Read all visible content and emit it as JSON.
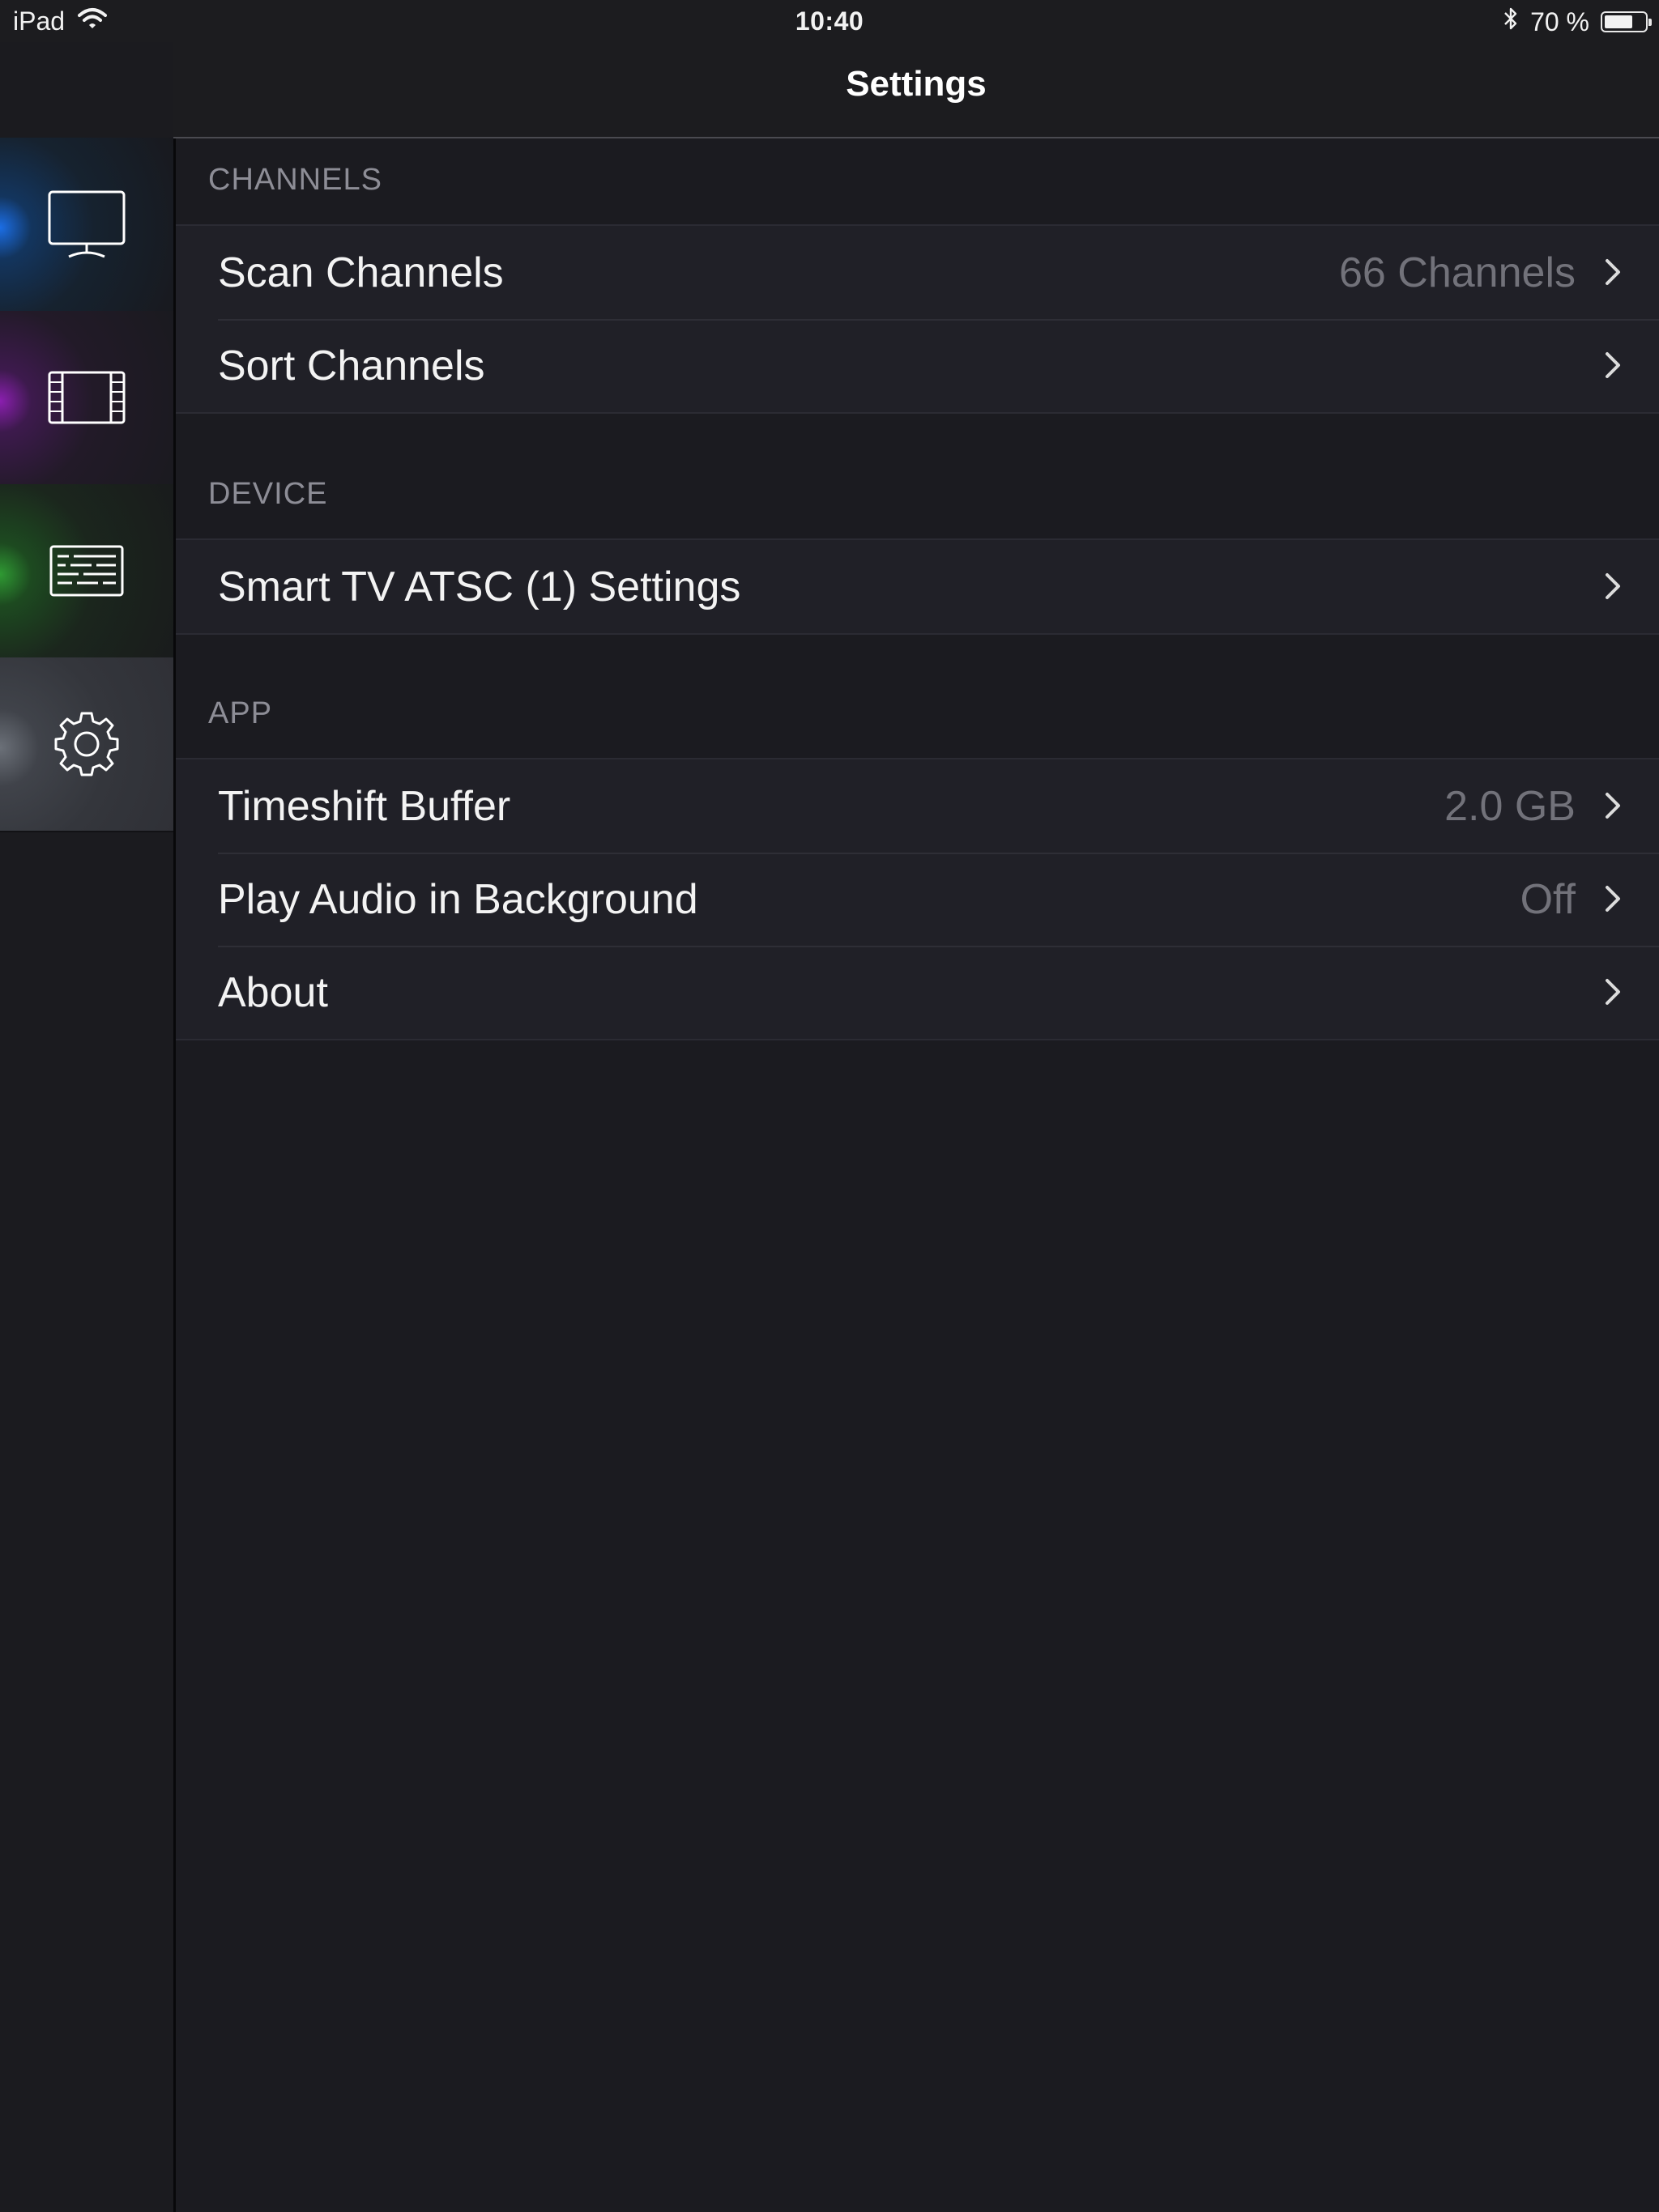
{
  "status_bar": {
    "device": "iPad",
    "time": "10:40",
    "battery_text": "70 %",
    "battery_level": 0.7
  },
  "sidebar": {
    "items": [
      {
        "name": "live-tv",
        "icon": "tv-monitor-icon",
        "glow": "#1b6ee6"
      },
      {
        "name": "recordings",
        "icon": "film-strip-icon",
        "glow": "#8b1fb0"
      },
      {
        "name": "guide",
        "icon": "program-guide-icon",
        "glow": "#2f9a33"
      },
      {
        "name": "settings",
        "icon": "gear-icon",
        "glow": "#6b7078",
        "selected": true
      }
    ]
  },
  "nav": {
    "title": "Settings"
  },
  "sections": [
    {
      "header": "CHANNELS",
      "rows": [
        {
          "label": "Scan Channels",
          "value": "66 Channels"
        },
        {
          "label": "Sort Channels",
          "value": ""
        }
      ]
    },
    {
      "header": "DEVICE",
      "rows": [
        {
          "label": "Smart TV ATSC (1) Settings",
          "value": ""
        }
      ]
    },
    {
      "header": "APP",
      "rows": [
        {
          "label": "Timeshift Buffer",
          "value": "2.0 GB"
        },
        {
          "label": "Play Audio in Background",
          "value": "Off"
        },
        {
          "label": "About",
          "value": ""
        }
      ]
    }
  ],
  "colors": {
    "background": "#1b1b20",
    "row_background": "#202027",
    "section_header": "#8d8d96",
    "value_text": "#72727a"
  }
}
